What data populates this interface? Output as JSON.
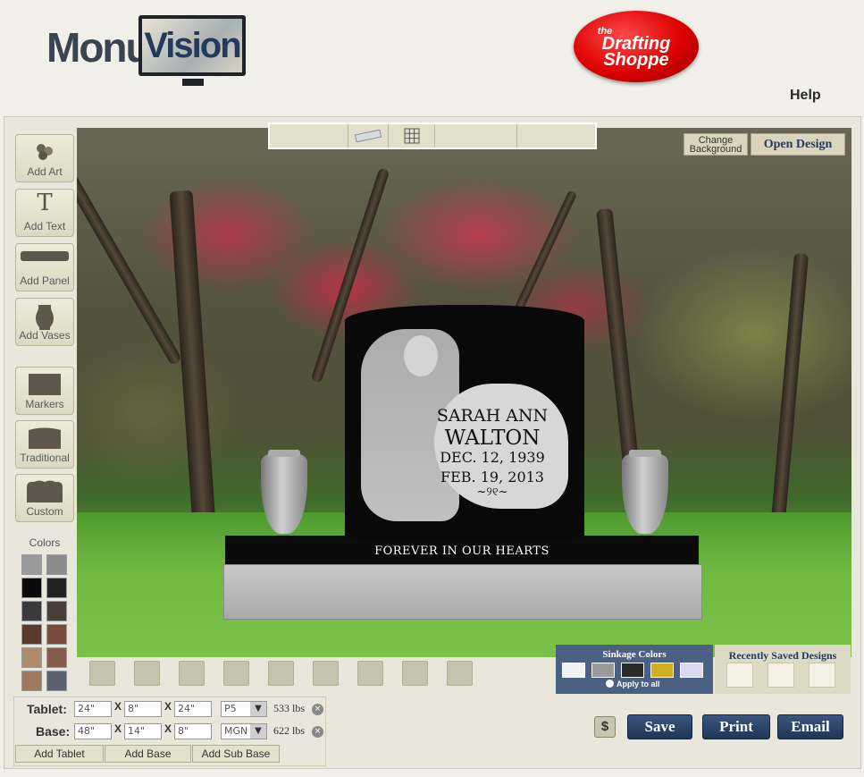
{
  "header": {
    "brand_part1": "Monu",
    "brand_part2": "Vision",
    "partner_small": "the",
    "partner_line1": "Drafting",
    "partner_line2": "Shoppe",
    "help": "Help"
  },
  "top_toolbar": {
    "icons": [
      "ruler-icon",
      "grid-icon"
    ]
  },
  "top_right": {
    "change_background": "Change Background",
    "open_design": "Open Design"
  },
  "tools": [
    {
      "label": "Add Art",
      "icon": "flower-icon"
    },
    {
      "label": "Add Text",
      "icon": "text-t-icon"
    },
    {
      "label": "Add Panel",
      "icon": "panel-icon"
    },
    {
      "label": "Add Vases",
      "icon": "vase-icon"
    },
    {
      "label": "Markers",
      "icon": "marker-icon"
    },
    {
      "label": "Traditional",
      "icon": "traditional-icon"
    },
    {
      "label": "Custom",
      "icon": "custom-icon"
    }
  ],
  "colors": {
    "label": "Colors",
    "swatches": [
      "#9a9a9a",
      "#8c8c8c",
      "#0a0a0a",
      "#222222",
      "#3a3a3a",
      "#4a3f35",
      "#5a3a2a",
      "#7a4a3a",
      "#b08a6a",
      "#8a5a4a",
      "#a07860",
      "#5a6270"
    ]
  },
  "epitaph": {
    "first": "SARAH ANN",
    "last": "WALTON",
    "date1": "DEC. 12, 1939",
    "date2": "FEB. 19, 2013",
    "ornament": "~୨୧~",
    "bottom": "FOREVER IN OUR HEARTS"
  },
  "sinkage": {
    "title": "Sinkage Colors",
    "colors": [
      "#f2f2f2",
      "#9a9a9a",
      "#2a2a2a",
      "#d1b020",
      "#dcd8f0"
    ],
    "apply_all": "Apply to all"
  },
  "recent": {
    "title": "Recently Saved Designs"
  },
  "dimensions": {
    "tablet": {
      "label": "Tablet:",
      "w": "24\"",
      "d": "8\"",
      "h": "24\"",
      "shape": "P5",
      "weight": "533 lbs"
    },
    "base": {
      "label": "Base:",
      "w": "48\"",
      "d": "14\"",
      "h": "8\"",
      "shape": "MGN",
      "weight": "622 lbs"
    },
    "x": "X",
    "close": "×",
    "arrow": "▼"
  },
  "add_buttons": [
    "Add Tablet",
    "Add Base",
    "Add Sub Base"
  ],
  "actions": {
    "price": "$",
    "save": "Save",
    "print": "Print",
    "email": "Email"
  }
}
